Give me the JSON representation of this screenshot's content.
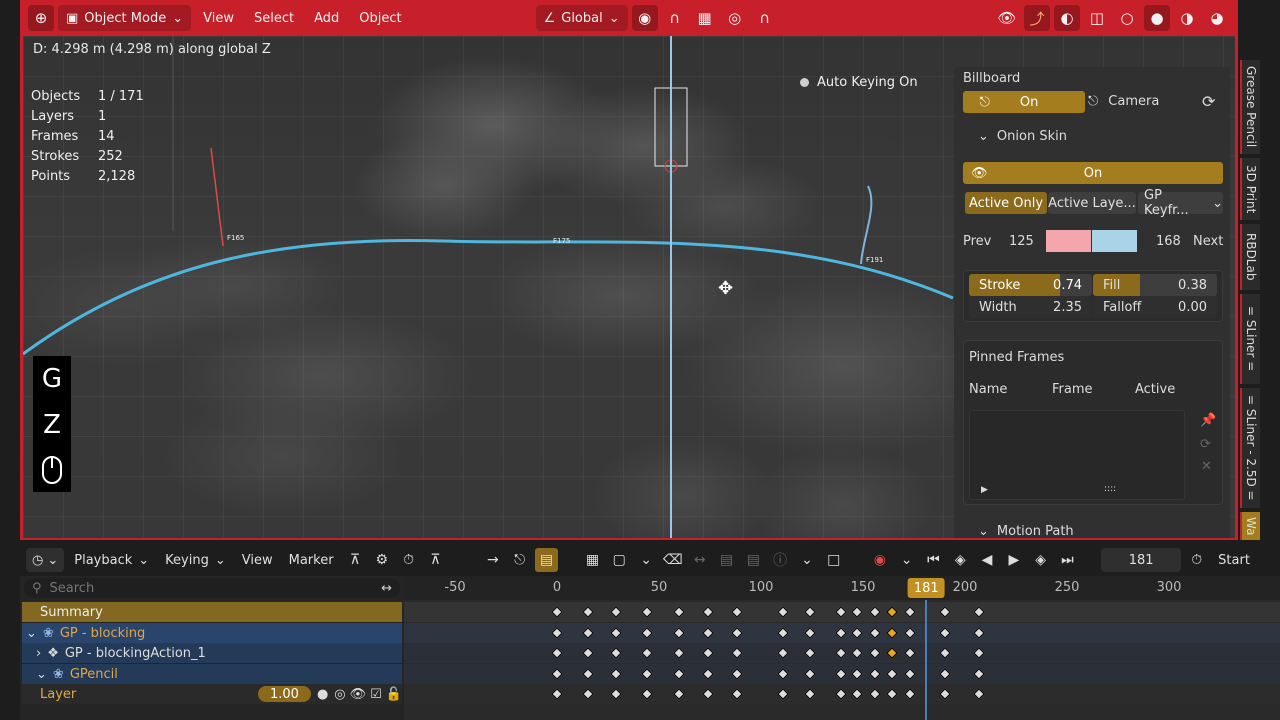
{
  "header": {
    "mode": "Object Mode",
    "menus": [
      "View",
      "Select",
      "Add",
      "Object"
    ],
    "transform_orientation": "Global"
  },
  "viewport": {
    "status": "D: 4.298 m (4.298 m) along global Z",
    "stats": [
      {
        "k": "Objects",
        "v": "1 / 171"
      },
      {
        "k": "Layers",
        "v": "1"
      },
      {
        "k": "Frames",
        "v": "14"
      },
      {
        "k": "Strokes",
        "v": "252"
      },
      {
        "k": "Points",
        "v": "2,128"
      }
    ],
    "auto_keying": "Auto Keying On",
    "key_overlay": [
      "G",
      "Z"
    ],
    "path_labels": [
      "F165",
      "F175",
      "F191"
    ]
  },
  "npanel": {
    "billboard_title": "Billboard",
    "billboard_on": "On",
    "camera": "Camera",
    "onion_skin": "Onion Skin",
    "onion_on": "On",
    "onion_modes": [
      "Active Only",
      "Active Laye...",
      "GP Keyfr..."
    ],
    "prev_label": "Prev",
    "prev_value": "125",
    "next_value": "168",
    "next_label": "Next",
    "prev_color": "#f4a6ad",
    "next_color": "#a9d3e6",
    "stroke_label": "Stroke",
    "stroke_value": "0.74",
    "fill_label": "Fill",
    "fill_value": "0.38",
    "width_label": "Width",
    "width_value": "2.35",
    "falloff_label": "Falloff",
    "falloff_value": "0.00",
    "pinned_frames": "Pinned Frames",
    "pinned_cols": [
      "Name",
      "Frame",
      "Active"
    ],
    "motion_path": "Motion Path"
  },
  "side_tabs": [
    "Grease Pencil",
    "3D Print",
    "RBDLab",
    "= SLiner =",
    "= SLiner - 2.5D =",
    "Wa"
  ],
  "timeline": {
    "menus": [
      "Playback",
      "Keying",
      "View",
      "Marker"
    ],
    "current_frame": "181",
    "start_label": "Start",
    "search_placeholder": "Search",
    "ruler_ticks": [
      "-50",
      "0",
      "50",
      "100",
      "150",
      "200",
      "250",
      "300"
    ],
    "channels": [
      {
        "label": "Summary",
        "kind": "summary"
      },
      {
        "label": "GP - blocking",
        "kind": "object"
      },
      {
        "label": "GP - blockingAction_1",
        "kind": "action"
      },
      {
        "label": "GPencil",
        "kind": "data"
      },
      {
        "label": "Layer",
        "kind": "layer",
        "value": "1.00"
      }
    ],
    "keyframes": [
      0,
      15,
      29,
      44,
      60,
      74,
      88,
      111,
      124,
      139,
      147,
      156,
      164,
      173,
      190,
      207
    ],
    "selected_key": 164
  },
  "colors": {
    "accent_red": "#c8202a",
    "accent_gold": "#a37d1e",
    "path_blue": "#4fb6dd"
  }
}
